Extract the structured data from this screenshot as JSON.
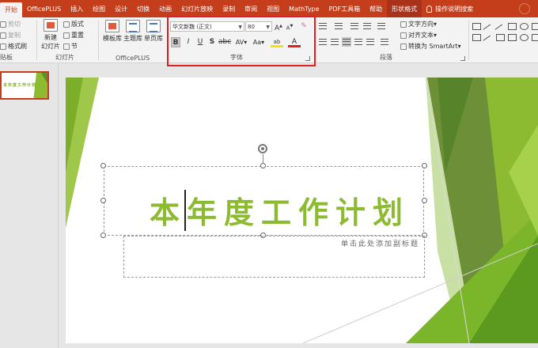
{
  "tabs": [
    "开始",
    "OfficePLUS",
    "插入",
    "绘图",
    "设计",
    "切换",
    "动画",
    "幻灯片放映",
    "录制",
    "审阅",
    "视图",
    "MathType",
    "PDF工具箱",
    "帮助",
    "形状格式",
    "操作说明搜索"
  ],
  "clipboard": {
    "cut": "剪切",
    "copy": "复制",
    "format_painter": "格式刷",
    "label": "贴板"
  },
  "slides_group": {
    "new_slide_1": "新建",
    "new_slide_2": "幻灯片",
    "layout": "版式",
    "reset": "重置",
    "section": "节",
    "label": "幻灯片"
  },
  "officeplus": {
    "template": "模板库",
    "theme": "主题库",
    "single_page": "单页库",
    "label": "OfficePLUS"
  },
  "font_group": {
    "font_name": "华文新魏 (正文)",
    "font_size": "80",
    "grow": "A",
    "shrink": "A",
    "bold": "B",
    "italic": "I",
    "underline": "U",
    "strike": "S",
    "spacing": "AV",
    "case": "Aa",
    "highlight": "ab",
    "color": "A",
    "label": "字体",
    "highlight_color": "#e02020"
  },
  "paragraph": {
    "text_direction": "文字方向",
    "align_text": "对齐文本",
    "smartart": "转换为 SmartArt",
    "label": "段落"
  },
  "slide": {
    "title": "本年度工作计划",
    "subtitle": "单击此处添加副标题",
    "thumb_title": "本年度工作计划",
    "accent_color": "#8cbb32"
  }
}
